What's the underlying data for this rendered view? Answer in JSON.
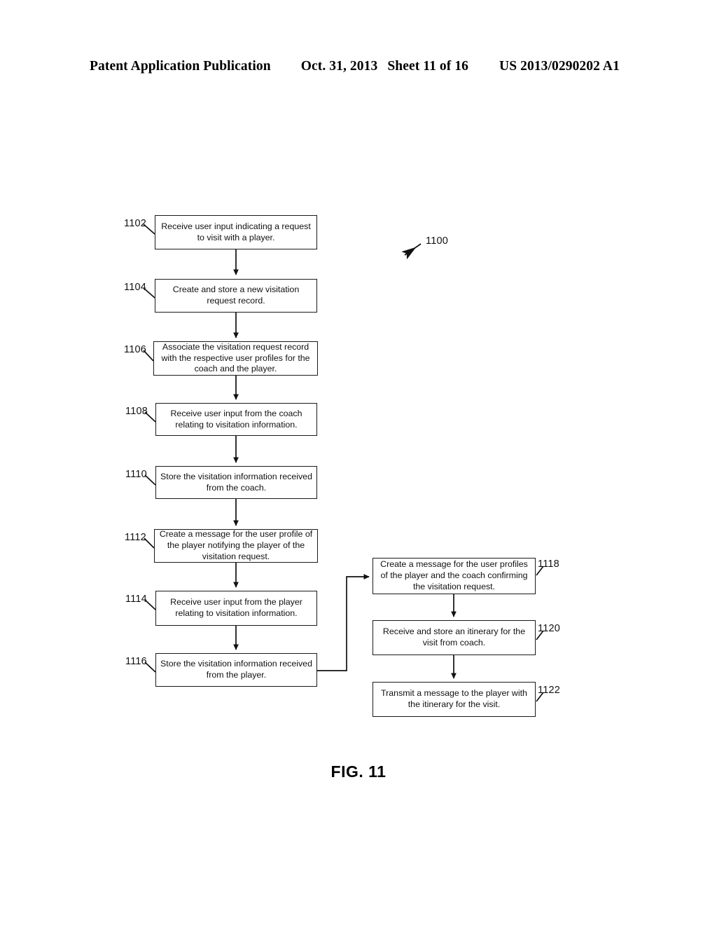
{
  "header": {
    "publication": "Patent Application Publication",
    "date": "Oct. 31, 2013",
    "sheet": "Sheet 11 of 16",
    "patent_number": "US 2013/0290202 A1"
  },
  "figure": {
    "caption": "FIG. 11",
    "diagram_ref": "1100",
    "type": "flowchart"
  },
  "boxes": [
    {
      "id": "1102",
      "text": "Receive user input indicating a request to visit with a player."
    },
    {
      "id": "1104",
      "text": "Create and store a new visitation request record."
    },
    {
      "id": "1106",
      "text": "Associate the visitation request record with the respective user profiles for the coach and the player."
    },
    {
      "id": "1108",
      "text": "Receive user input from the coach relating to visitation information."
    },
    {
      "id": "1110",
      "text": "Store the visitation information received from the coach."
    },
    {
      "id": "1112",
      "text": "Create a message for the user profile of the player notifying the player of the visitation request."
    },
    {
      "id": "1114",
      "text": "Receive user input from the player relating to visitation information."
    },
    {
      "id": "1116",
      "text": "Store the visitation information received from the player."
    },
    {
      "id": "1118",
      "text": "Create a message for the user profiles of the player and the coach confirming the visitation request."
    },
    {
      "id": "1120",
      "text": "Receive and store an itinerary for the visit from coach."
    },
    {
      "id": "1122",
      "text": "Transmit a message to the player with the itinerary for the visit."
    }
  ],
  "colors": {
    "ink": "#111111",
    "paper": "#ffffff"
  }
}
